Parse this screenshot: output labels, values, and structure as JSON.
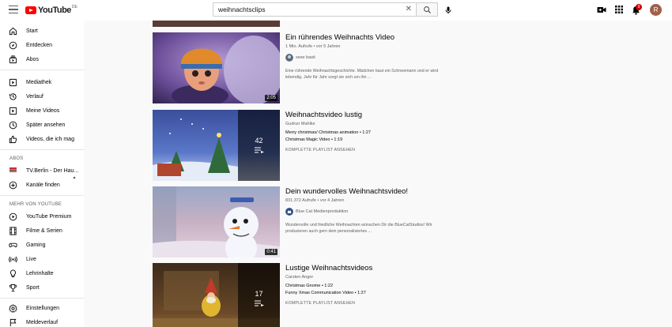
{
  "header": {
    "logo_text": "YouTube",
    "logo_country": "DE",
    "search_value": "weihnachtsclips",
    "notification_count": "9",
    "avatar_letter": "R"
  },
  "sidebar": {
    "main": [
      {
        "label": "Start",
        "icon": "home-icon"
      },
      {
        "label": "Entdecken",
        "icon": "compass-icon"
      },
      {
        "label": "Abos",
        "icon": "subscriptions-icon"
      }
    ],
    "library": [
      {
        "label": "Mediathek",
        "icon": "library-icon"
      },
      {
        "label": "Verlauf",
        "icon": "history-icon"
      },
      {
        "label": "Meine Videos",
        "icon": "my-videos-icon"
      },
      {
        "label": "Später ansehen",
        "icon": "clock-icon"
      },
      {
        "label": "Videos, die ich mag",
        "icon": "thumbs-up-icon"
      }
    ],
    "abos_heading": "ABOS",
    "subscriptions": [
      {
        "label": "TV.Berlin - Der Hau..."
      },
      {
        "label": "Kanäle finden",
        "icon": "add-circle-icon"
      }
    ],
    "more_heading": "MEHR VON YOUTUBE",
    "more": [
      {
        "label": "YouTube Premium",
        "icon": "youtube-premium-icon"
      },
      {
        "label": "Filme & Serien",
        "icon": "film-icon"
      },
      {
        "label": "Gaming",
        "icon": "gaming-icon"
      },
      {
        "label": "Live",
        "icon": "live-icon"
      },
      {
        "label": "Lehrinhalte",
        "icon": "lightbulb-icon"
      },
      {
        "label": "Sport",
        "icon": "trophy-icon"
      }
    ],
    "settings": [
      {
        "label": "Einstellungen",
        "icon": "gear-icon"
      },
      {
        "label": "Meldeverlauf",
        "icon": "flag-icon"
      }
    ]
  },
  "videos": [
    {
      "title": "Ein rührendes Weihnachts Video",
      "meta": "1 Mio. Aufrufe • vor 5 Jahren",
      "channel": "sese basti",
      "description_line1": "Eine rührende Weihnachtsgeschichte. Mädchen baut ein Schneemann und er wird",
      "description_line2": "lebendig. Jahr für Jahr sorgt sie sich um ihn ...",
      "duration": "2:05"
    },
    {
      "title": "Weihnachtsvideo lustig",
      "channel": "Gudrun Mahlke",
      "playlist_items": [
        "Merry christmas/ Christmas animation • 1:27",
        "Christmas Magic Video • 1:19"
      ],
      "playlist_all": "KOMPLETTE PLAYLIST ANSEHEN",
      "count": "42"
    },
    {
      "title": "Dein wundervolles Weihnachtsvideo!",
      "meta": "831.372 Aufrufe • vor 4 Jahren",
      "channel": "Blue Cat Medienproduktion",
      "description_line1": "Wundervolle und friedliche Weihnachten wünschen Dir die BlueCatStudios! Wir",
      "description_line2": "produzieren auch gern dein personalisiertes ...",
      "duration": "0:41"
    },
    {
      "title": "Lustige Weihnachtsvideos",
      "channel": "Carsten Anger",
      "playlist_items": [
        "Christmas Gnome • 1:22",
        "Funny Xmas Communication Video • 1:27"
      ],
      "playlist_all": "KOMPLETTE PLAYLIST ANSEHEN",
      "count": "17"
    }
  ]
}
